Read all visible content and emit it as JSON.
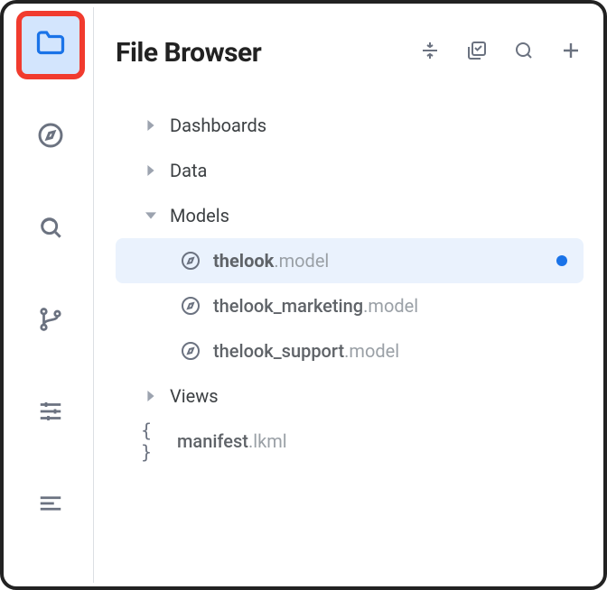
{
  "panel": {
    "title": "File Browser"
  },
  "tree": {
    "dashboards": {
      "label": "Dashboards"
    },
    "data": {
      "label": "Data"
    },
    "models": {
      "label": "Models",
      "thelook": {
        "name": "thelook",
        "ext": ".model"
      },
      "marketing": {
        "name": "thelook_marketing",
        "ext": ".model"
      },
      "support": {
        "name": "thelook_support",
        "ext": ".model"
      }
    },
    "views": {
      "label": "Views"
    },
    "manifest": {
      "name": "manifest",
      "ext": ".lkml"
    }
  },
  "colors": {
    "accent": "#1a73e8",
    "highlight_outline": "#f13b2e",
    "selected_bg": "#eaf2fd"
  }
}
